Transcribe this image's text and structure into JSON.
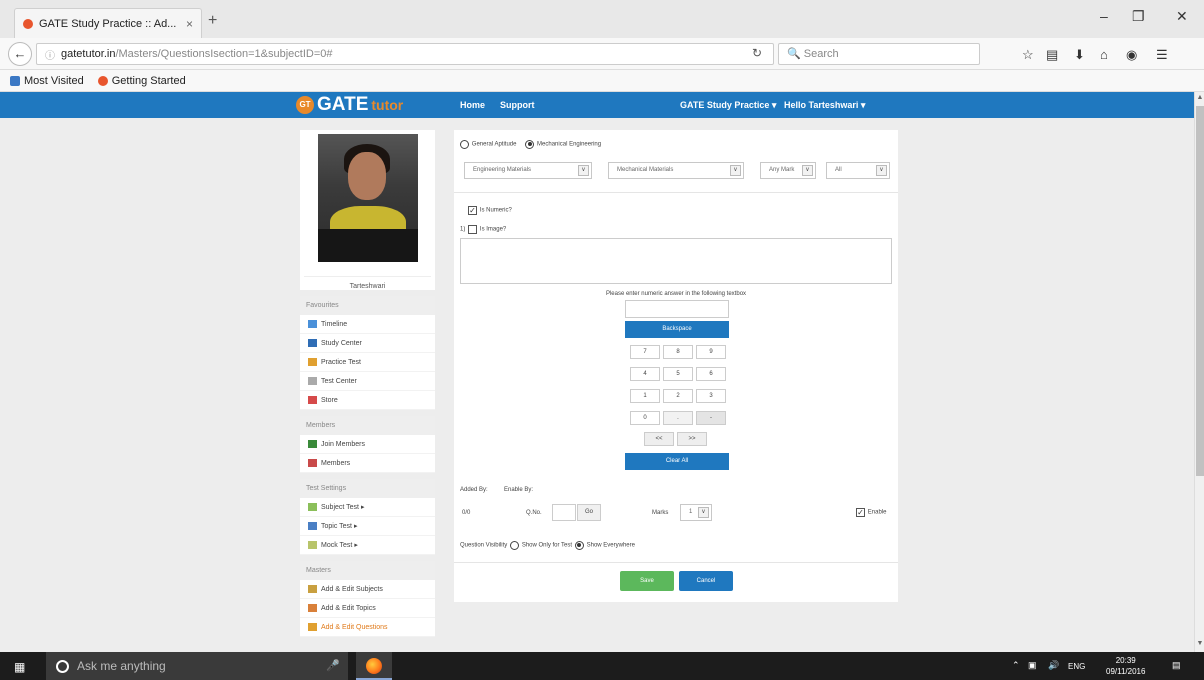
{
  "browser": {
    "tab_title": "GATE Study Practice :: Ad...",
    "tab_close": "×",
    "new_tab": "+",
    "url_domain": "gatetutor.in",
    "url_path": "/Masters/QuestionsIsection=1&subjectID=0#",
    "search_placeholder": "Search",
    "bookmarks": [
      "Most Visited",
      "Getting Started"
    ]
  },
  "site": {
    "logo_badge": "GT",
    "logo_main": "GATE",
    "logo_accent": "tutor",
    "nav_home": "Home",
    "nav_support": "Support",
    "nav_practice": "GATE Study Practice ▾",
    "nav_user": "Hello Tarteshwari ▾"
  },
  "sidebar": {
    "profile_name": "Tarteshwari",
    "favourites_header": "Favourites",
    "favourites": [
      "Timeline",
      "Study Center",
      "Practice Test",
      "Test Center",
      "Store"
    ],
    "members_header": "Members",
    "members": [
      "Join Members",
      "Members"
    ],
    "test_settings_header": "Test Settings",
    "test_settings": [
      "Subject Test ▸",
      "Topic Test ▸",
      "Mock Test ▸"
    ],
    "masters_header": "Masters",
    "masters": [
      "Add & Edit Subjects",
      "Add & Edit Topics",
      "Add & Edit Questions"
    ]
  },
  "form": {
    "radio_general": "General Aptitude",
    "radio_mech": "Mechanical Engineering",
    "subject_select": "Engineering Materials",
    "topic_select": "Mechanical Materials",
    "marks_select": "Any Mark",
    "all_select": "All",
    "is_numeric": "Is Numeric?",
    "q_prefix": "1)",
    "is_image": "Is Image?",
    "numeric_prompt": "Please enter numeric answer in the following textbox",
    "backspace": "Backspace",
    "keys": [
      "7",
      "8",
      "9",
      "4",
      "5",
      "6",
      "1",
      "2",
      "3",
      "0",
      ".",
      "-"
    ],
    "arrow_left": "<<",
    "arrow_right": ">>",
    "clear_all": "Clear All",
    "added_by": "Added By:",
    "enable_by": "Enable By:",
    "counter": "0/0",
    "qno_label": "Q.No.",
    "go": "Go",
    "marks_label": "Marks",
    "marks_value": "1",
    "enable": "Enable",
    "visibility_label": "Question Visibility",
    "visibility_only": "Show Only for Test",
    "visibility_all": "Show Everywhere",
    "save": "Save",
    "cancel": "Cancel"
  },
  "taskbar": {
    "search_placeholder": "Ask me anything",
    "lang": "ENG",
    "time": "20:39",
    "date": "09/11/2016"
  }
}
